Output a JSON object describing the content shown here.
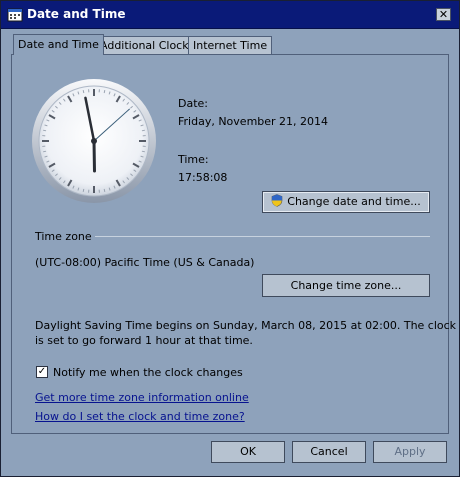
{
  "window": {
    "title": "Date and Time",
    "close_label": "✕"
  },
  "tabs": [
    "Date and Time",
    "Additional Clocks",
    "Internet Time"
  ],
  "clock": {
    "hour": 17,
    "minute": 58,
    "second": 8
  },
  "date": {
    "label": "Date:",
    "value": "Friday, November 21, 2014"
  },
  "time": {
    "label": "Time:",
    "value": "17:58:08"
  },
  "buttons": {
    "change_date_time": "Change date and time...",
    "change_time_zone": "Change time zone...",
    "ok": "OK",
    "cancel": "Cancel",
    "apply": "Apply"
  },
  "timezone": {
    "section_label": "Time zone",
    "value": "(UTC-08:00) Pacific Time (US & Canada)"
  },
  "dst": {
    "line1": "Daylight Saving Time begins on Sunday, March 08, 2015 at 02:00. The clock",
    "line2": "is set to go forward 1 hour at that time."
  },
  "notify": {
    "label": "Notify me when the clock changes",
    "checked": "✓"
  },
  "links": {
    "more_info": "Get more time zone information online",
    "how_to": "How do I set the clock and time zone?"
  },
  "colors": {
    "titlebar": "#0a1a78",
    "window_bg": "#8ea2bb",
    "link": "#07138f"
  }
}
